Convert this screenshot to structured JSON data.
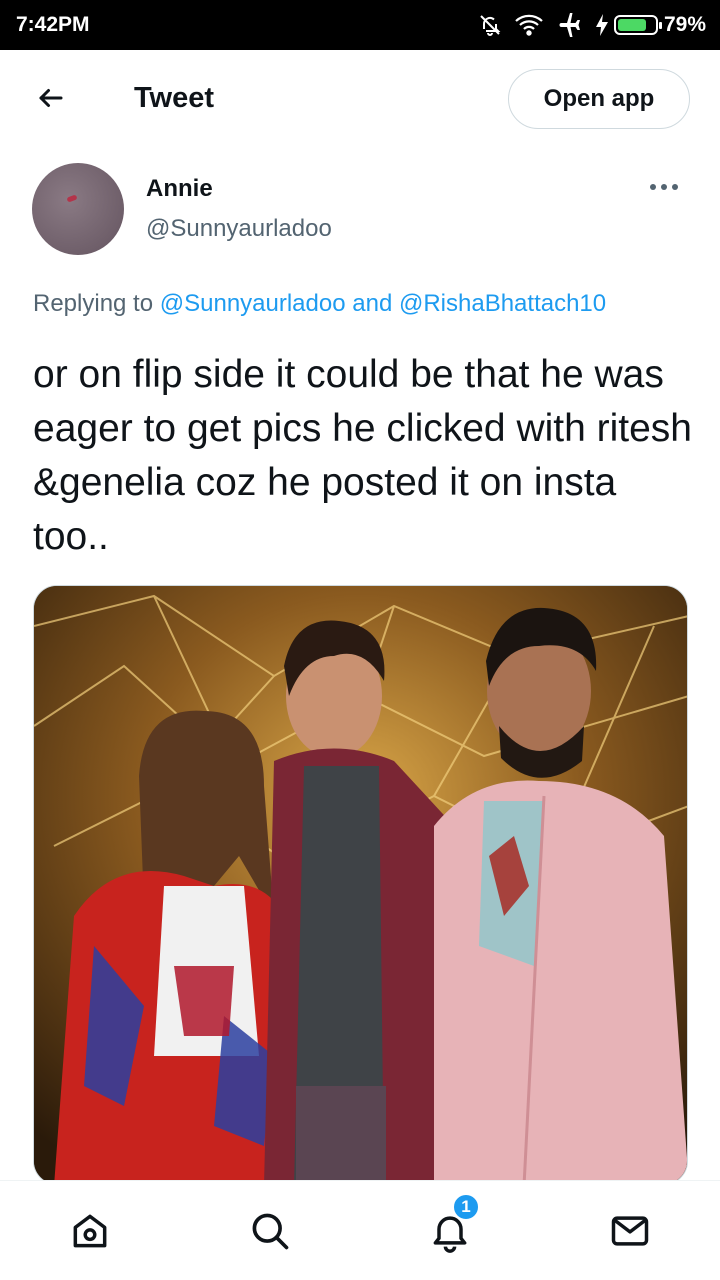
{
  "status_bar": {
    "time": "7:42PM",
    "battery_percent": "79%",
    "battery_level": 0.79,
    "icons": [
      "alarm-off-icon",
      "wifi-icon",
      "airplane-icon",
      "charging-icon",
      "battery-icon"
    ]
  },
  "header": {
    "back_icon": "arrow-left-icon",
    "title": "Tweet",
    "open_app_label": "Open app"
  },
  "tweet": {
    "author": {
      "display_name": "Annie",
      "handle": "@Sunnyaurladoo",
      "avatar": "avatar-image"
    },
    "more_icon": "more-horizontal-icon",
    "reply": {
      "prefix": "Replying to ",
      "user1": "@Sunnyaurladoo",
      "conjunction": " and ",
      "user2": "@RishaBhattach10"
    },
    "text": "or on flip side it could be that he was eager to get pics he clicked with ritesh &genelia coz he posted it on insta too..",
    "media": "photo of three people posing on a stage with a golden geometric backdrop"
  },
  "tab_bar": {
    "tabs": [
      {
        "name": "home",
        "icon": "home-icon"
      },
      {
        "name": "search",
        "icon": "search-icon"
      },
      {
        "name": "notifications",
        "icon": "bell-icon",
        "badge": "1"
      },
      {
        "name": "messages",
        "icon": "mail-icon"
      }
    ]
  },
  "colors": {
    "accent": "#1d9bf0",
    "text_primary": "#0f1419",
    "text_secondary": "#536471",
    "border": "#cfd9de"
  }
}
